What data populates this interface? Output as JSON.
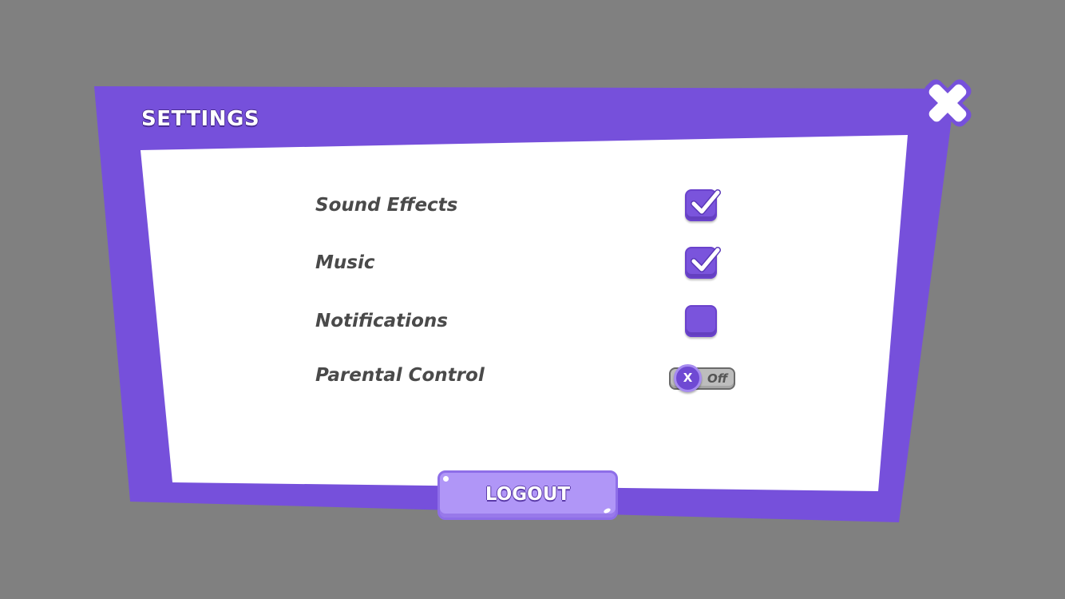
{
  "dialog": {
    "title": "SETTINGS",
    "close_icon": "close-icon"
  },
  "settings": [
    {
      "label": "Sound Effects",
      "control": "checkbox",
      "checked": true,
      "icon": "checkmark-icon"
    },
    {
      "label": "Music",
      "control": "checkbox",
      "checked": true,
      "icon": "checkmark-icon"
    },
    {
      "label": "Notifications",
      "control": "checkbox",
      "checked": false
    },
    {
      "label": "Parental Control",
      "control": "toggle",
      "on": false,
      "knob_label": "X",
      "state_label": "Off"
    }
  ],
  "logout": {
    "label": "LOGOUT"
  },
  "colors": {
    "background": "#808080",
    "frame": "#7650db",
    "panel": "#ffffff",
    "checkbox": "#7a54dc",
    "logout_button": "#b096f7",
    "label_text": "#4a4a4a"
  }
}
